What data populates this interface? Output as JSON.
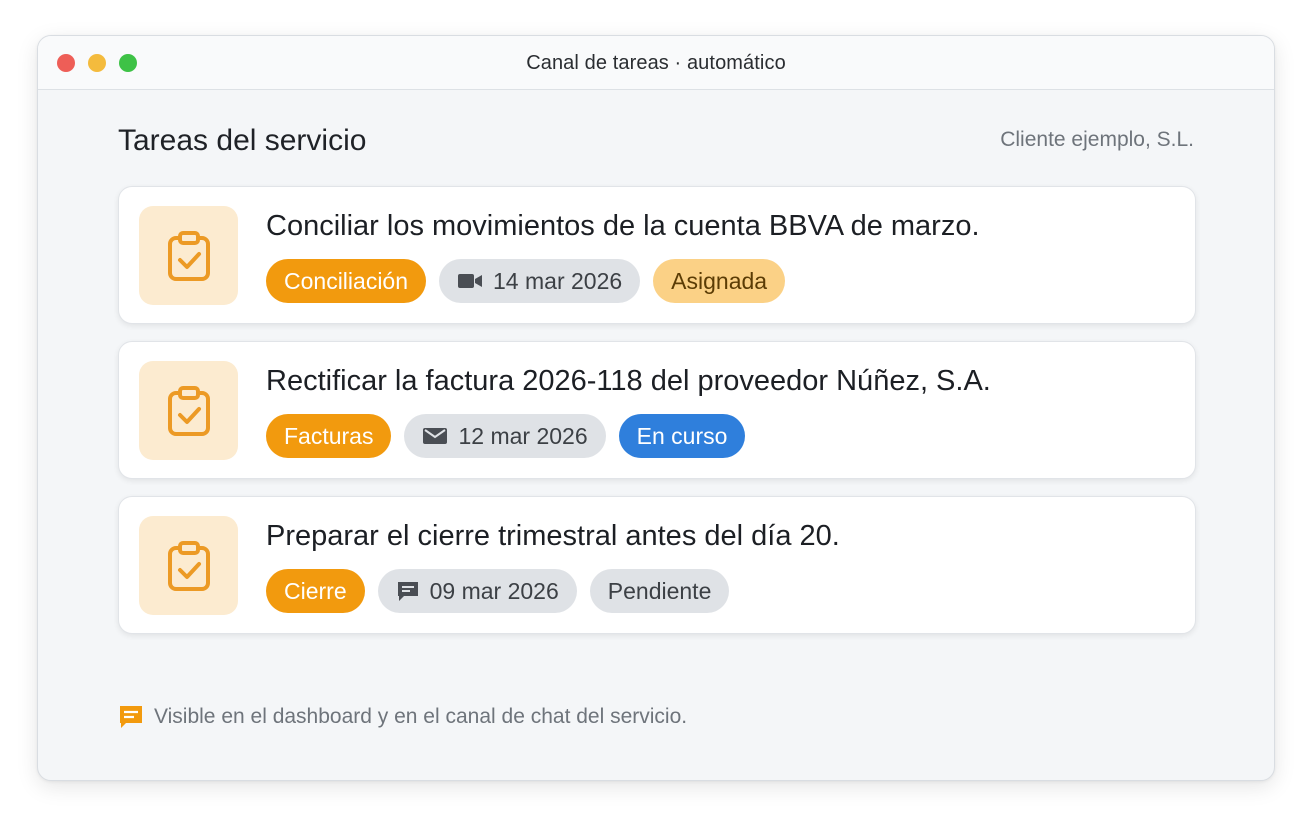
{
  "window": {
    "title": "Canal de tareas · automático"
  },
  "header": {
    "title": "Tareas del servicio",
    "client": "Cliente ejemplo, S.L."
  },
  "tasks": [
    {
      "text": "Conciliar los movimientos de la cuenta BBVA de marzo.",
      "category": "Conciliación",
      "date": "14 mar 2026",
      "date_icon": "video-camera-icon",
      "status": "Asignada",
      "status_color": "#fbd186"
    },
    {
      "text": "Rectificar la factura 2026-118 del proveedor Núñez, S.A.",
      "category": "Facturas",
      "date": "12 mar 2026",
      "date_icon": "mail-icon",
      "status": "En curso",
      "status_color": "#2f7fdc"
    },
    {
      "text": "Preparar el cierre trimestral antes del día 20.",
      "category": "Cierre",
      "date": "09 mar 2026",
      "date_icon": "chat-bubble-icon",
      "status": "Pendiente",
      "status_color": "#dfe2e6"
    }
  ],
  "task_icon": "clipboard-check-icon",
  "footer": {
    "icon": "chat-note-icon",
    "text": "Visible en el dashboard y en el canal de chat del servicio."
  },
  "colors": {
    "accent": "#f29a0e",
    "icon_bg": "#fcebd0",
    "window_bg": "#f4f6f8"
  }
}
